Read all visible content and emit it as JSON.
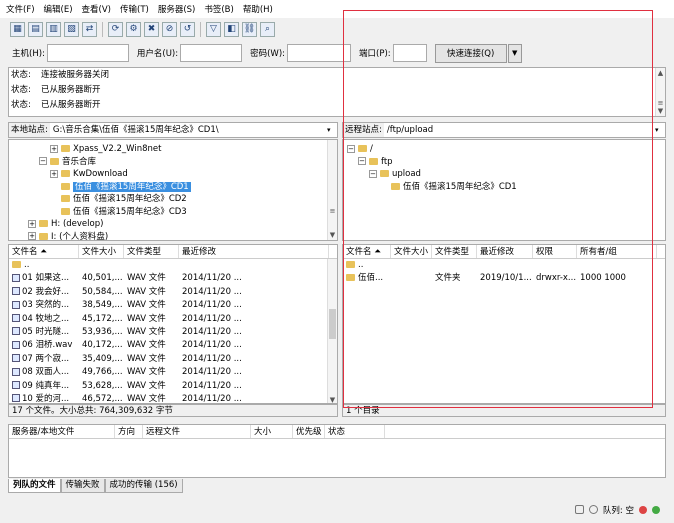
{
  "menu": [
    "文件(F)",
    "编辑(E)",
    "查看(V)",
    "传输(T)",
    "服务器(S)",
    "书签(B)",
    "帮助(H)"
  ],
  "toolbar_icons": [
    "site-manager-icon",
    "log-toggle-icon",
    "local-tree-icon",
    "remote-tree-icon",
    "queue-icon",
    "refresh-icon",
    "process-queue-icon",
    "cancel-icon",
    "disconnect-icon",
    "reconnect-icon",
    "filter-icon",
    "compare-icon",
    "sync-browse-icon",
    "search-icon"
  ],
  "quickconnect": {
    "host_label": "主机(H):",
    "user_label": "用户名(U):",
    "pass_label": "密码(W):",
    "port_label": "端口(P):",
    "button": "快速连接(Q)",
    "dropdown": "▼"
  },
  "log": [
    {
      "k": "状态:",
      "v": "连接被服务器关闭"
    },
    {
      "k": "状态:",
      "v": "已从服务器断开"
    },
    {
      "k": "状态:",
      "v": "已从服务器断开"
    }
  ],
  "local": {
    "site_label": "本地站点:",
    "site_path": "G:\\音乐合集\\伍佰《摇滚15周年纪念》CD1\\",
    "tree": [
      {
        "indent": 3,
        "exp": "⊞",
        "label": "Xpass_V2.2_Win8net",
        "sel": false
      },
      {
        "indent": 2,
        "exp": "⊟",
        "label": "音乐合库",
        "sel": false
      },
      {
        "indent": 3,
        "exp": "⊞",
        "label": "KwDownload",
        "sel": false
      },
      {
        "indent": 3,
        "exp": "",
        "label": "伍佰《摇滚15周年纪念》CD1",
        "sel": true
      },
      {
        "indent": 3,
        "exp": "",
        "label": "伍佰《摇滚15周年纪念》CD2",
        "sel": false
      },
      {
        "indent": 3,
        "exp": "",
        "label": "伍佰《摇滚15周年纪念》CD3",
        "sel": false
      },
      {
        "indent": 1,
        "exp": "⊞",
        "label": "H: (develop)",
        "sel": false
      },
      {
        "indent": 1,
        "exp": "⊞",
        "label": "I: (个人资料盘)",
        "sel": false
      }
    ],
    "headers": [
      "文件名 ⏶",
      "文件大小",
      "文件类型",
      "最近修改"
    ],
    "files": [
      [
        "..",
        "",
        "",
        ""
      ],
      [
        "01 如果这...",
        "40,501,...",
        "WAV 文件",
        "2014/11/20 ..."
      ],
      [
        "02 我会好...",
        "50,584,...",
        "WAV 文件",
        "2014/11/20 ..."
      ],
      [
        "03 突然的...",
        "38,549,...",
        "WAV 文件",
        "2014/11/20 ..."
      ],
      [
        "04 牧地之...",
        "45,172,...",
        "WAV 文件",
        "2014/11/20 ..."
      ],
      [
        "05 时光隧...",
        "53,936,...",
        "WAV 文件",
        "2014/11/20 ..."
      ],
      [
        "06 泪桥.wav",
        "40,172,...",
        "WAV 文件",
        "2014/11/20 ..."
      ],
      [
        "07 两个寂...",
        "35,409,...",
        "WAV 文件",
        "2014/11/20 ..."
      ],
      [
        "08 双面人...",
        "49,766,...",
        "WAV 文件",
        "2014/11/20 ..."
      ],
      [
        "09 纯真年...",
        "53,628,...",
        "WAV 文件",
        "2014/11/20 ..."
      ],
      [
        "10 爱的河...",
        "46,572,...",
        "WAV 文件",
        "2014/11/20 ..."
      ]
    ],
    "status": "17 个文件。大小总共: 764,309,632 字节"
  },
  "remote": {
    "site_label": "远程站点:",
    "site_path": "/ftp/upload",
    "tree": [
      {
        "indent": 0,
        "exp": "⊟",
        "label": "/",
        "sel": false
      },
      {
        "indent": 1,
        "exp": "⊟",
        "label": "ftp",
        "sel": false
      },
      {
        "indent": 2,
        "exp": "⊟",
        "label": "upload",
        "sel": false
      },
      {
        "indent": 3,
        "exp": "",
        "label": "伍佰《摇滚15周年纪念》CD1",
        "sel": false
      }
    ],
    "headers": [
      "文件名 ⏶",
      "文件大小",
      "文件类型",
      "最近修改",
      "权限",
      "所有者/组"
    ],
    "files": [
      [
        "..",
        "",
        "",
        "",
        "",
        ""
      ],
      [
        "伍佰...",
        "",
        "文件夹",
        "2019/10/1...",
        "drwxr-x...",
        "1000 1000"
      ]
    ],
    "status": "1 个目录"
  },
  "queue": {
    "headers": [
      "服务器/本地文件",
      "方向",
      "远程文件",
      "大小",
      "优先级",
      "状态"
    ]
  },
  "tabs": [
    "列队的文件",
    "传输失败",
    "成功的传输 (156)"
  ],
  "statusbar": {
    "queue_label": "队列: 空"
  }
}
